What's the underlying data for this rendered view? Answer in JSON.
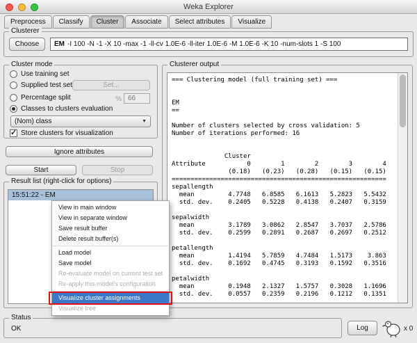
{
  "window": {
    "title": "Weka Explorer"
  },
  "tabs": {
    "items": [
      "Preprocess",
      "Classify",
      "Cluster",
      "Associate",
      "Select attributes",
      "Visualize"
    ],
    "active": "Cluster"
  },
  "clusterer": {
    "label": "Clusterer",
    "choose_button": "Choose",
    "scheme": "EM",
    "params": "-I 100 -N -1 -X 10 -max -1 -ll-cv 1.0E-6 -ll-iter 1.0E-6 -M 1.0E-6 -K 10 -num-slots 1 -S 100"
  },
  "cluster_mode": {
    "label": "Cluster mode",
    "use_training_set": "Use training set",
    "supplied_test_set": "Supplied test set",
    "set_button": "Set...",
    "percentage_split": "Percentage split",
    "percent_label": "%",
    "percent_value": "66",
    "classes_to_clusters": "Classes to clusters evaluation",
    "class_attribute": "(Nom) class",
    "store_clusters": "Store clusters for visualization"
  },
  "buttons": {
    "ignore_attributes": "Ignore attributes",
    "start": "Start",
    "stop": "Stop"
  },
  "result_list": {
    "label": "Result list (right-click for options)",
    "items": [
      "15:51:22 - EM"
    ]
  },
  "context_menu": {
    "items": [
      {
        "label": "View in main window",
        "enabled": true
      },
      {
        "label": "View in separate window",
        "enabled": true
      },
      {
        "label": "Save result buffer",
        "enabled": true
      },
      {
        "label": "Delete result buffer(s)",
        "enabled": true
      },
      {
        "label": "Load model",
        "enabled": true
      },
      {
        "label": "Save model",
        "enabled": true
      },
      {
        "label": "Re-evaluate model on current test set",
        "enabled": false
      },
      {
        "label": "Re-apply this model's configuration",
        "enabled": false
      },
      {
        "label": "Visualize cluster assignments",
        "enabled": true,
        "highlighted": true
      },
      {
        "label": "Visualize tree",
        "enabled": false
      }
    ]
  },
  "clusterer_output": {
    "label": "Clusterer output",
    "text": "=== Clustering model (full training set) ===\n\n\nEM\n==\n\nNumber of clusters selected by cross validation: 5\nNumber of iterations performed: 16\n\n\n              Cluster\nAttribute           0        1        2        3        4\n               (0.18)   (0.23)   (0.28)   (0.15)   (0.15)\n=========================================================\nsepallength\n  mean         4.7748   6.8585   6.1613   5.2823   5.5432\n  std. dev.    0.2405   0.5228   0.4138   0.2407   0.3159\n\nsepalwidth\n  mean         3.1789   3.0862   2.8547   3.7037   2.5786\n  std. dev.    0.2599   0.2891   0.2687   0.2697   0.2512\n\npetallength\n  mean         1.4194   5.7859   4.7484   1.5173    3.863\n  std. dev.    0.1692   0.4745   0.3193   0.1592   0.3516\n\npetalwidth\n  mean         0.1948   2.1327   1.5757   0.3028   1.1696\n  std. dev.    0.0557   0.2359   0.2196   0.1212   0.1351"
  },
  "status": {
    "label": "Status",
    "message": "OK",
    "log_button": "Log",
    "memory_indicator": "x 0"
  }
}
